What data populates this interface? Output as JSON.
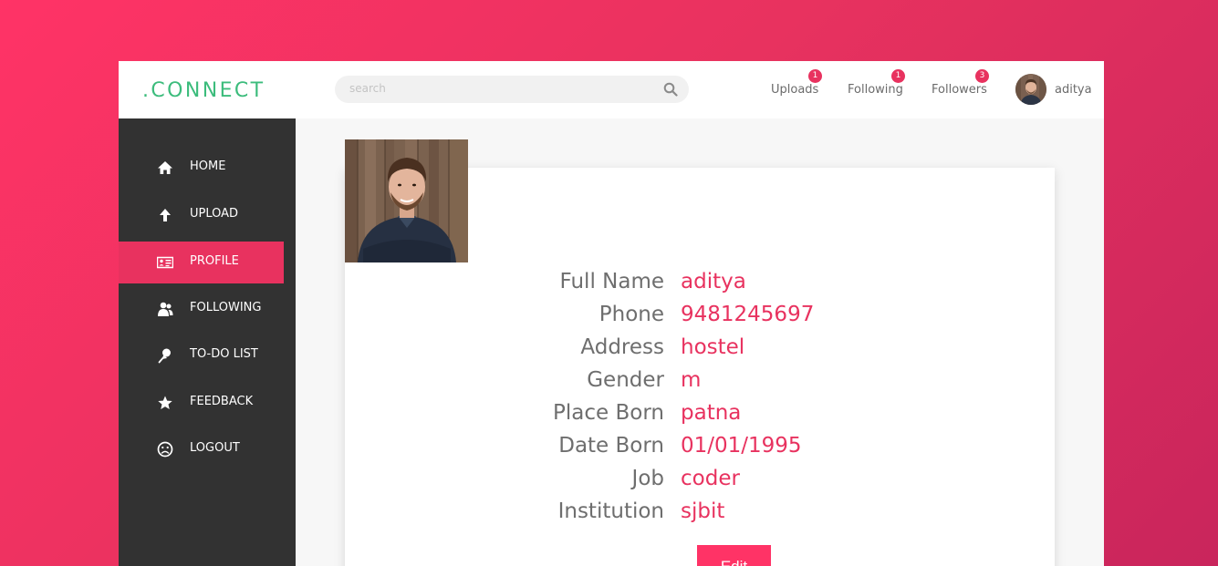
{
  "header": {
    "logo": ".CONNECT",
    "search_placeholder": "search",
    "nav": [
      {
        "label": "Uploads",
        "badge": "1"
      },
      {
        "label": "Following",
        "badge": "1"
      },
      {
        "label": "Followers",
        "badge": "3"
      }
    ],
    "username": "aditya"
  },
  "sidebar": {
    "items": [
      {
        "label": "HOME",
        "icon": "home-icon"
      },
      {
        "label": "UPLOAD",
        "icon": "upload-arrow-icon"
      },
      {
        "label": "PROFILE",
        "icon": "id-card-icon",
        "active": true
      },
      {
        "label": "FOLLOWING",
        "icon": "users-icon"
      },
      {
        "label": "TO-DO LIST",
        "icon": "pin-icon"
      },
      {
        "label": "FEEDBACK",
        "icon": "star-icon"
      },
      {
        "label": "LOGOUT",
        "icon": "sad-face-icon"
      }
    ]
  },
  "profile": {
    "fields": [
      {
        "label": "Full Name",
        "value": "aditya"
      },
      {
        "label": "Phone",
        "value": "9481245697"
      },
      {
        "label": "Address",
        "value": "hostel"
      },
      {
        "label": "Gender",
        "value": "m"
      },
      {
        "label": "Place Born",
        "value": "patna"
      },
      {
        "label": "Date Born",
        "value": "01/01/1995"
      },
      {
        "label": "Job",
        "value": "coder"
      },
      {
        "label": "Institution",
        "value": "sjbit"
      }
    ],
    "edit_label": "Edit"
  },
  "colors": {
    "accent": "#e8325f",
    "logo": "#3cbc7c",
    "sidebar": "#323232"
  }
}
